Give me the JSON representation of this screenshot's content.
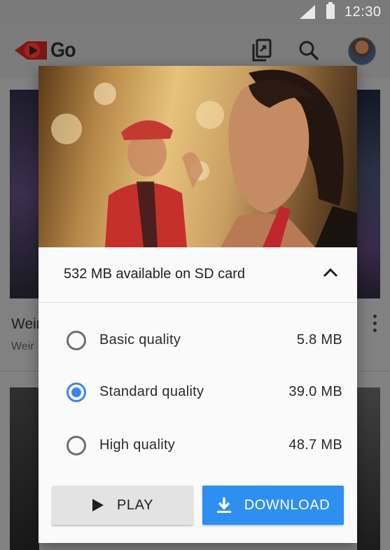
{
  "status_bar": {
    "time": "12:30"
  },
  "app": {
    "name": "Go",
    "brand_color": "#e62117"
  },
  "icons": {
    "logo": "youtube-play-logo-icon",
    "downloads": "downloads-library-icon",
    "search": "search-icon",
    "avatar": "user-avatar",
    "more": "more-vert-icon",
    "collapse": "chevron-up-icon",
    "play": "play-icon",
    "download": "download-icon"
  },
  "background": {
    "video_title_partial": "Weir",
    "video_subtitle_partial": "Weir"
  },
  "dialog": {
    "storage_text": "532 MB available on SD card",
    "options": [
      {
        "label": "Basic quality",
        "size": "5.8 MB",
        "selected": false
      },
      {
        "label": "Standard quality",
        "size": "39.0 MB",
        "selected": true
      },
      {
        "label": "High quality",
        "size": "48.7 MB",
        "selected": false
      }
    ],
    "play_label": "PLAY",
    "download_label": "DOWNLOAD",
    "accent_color": "#3f84e5"
  }
}
